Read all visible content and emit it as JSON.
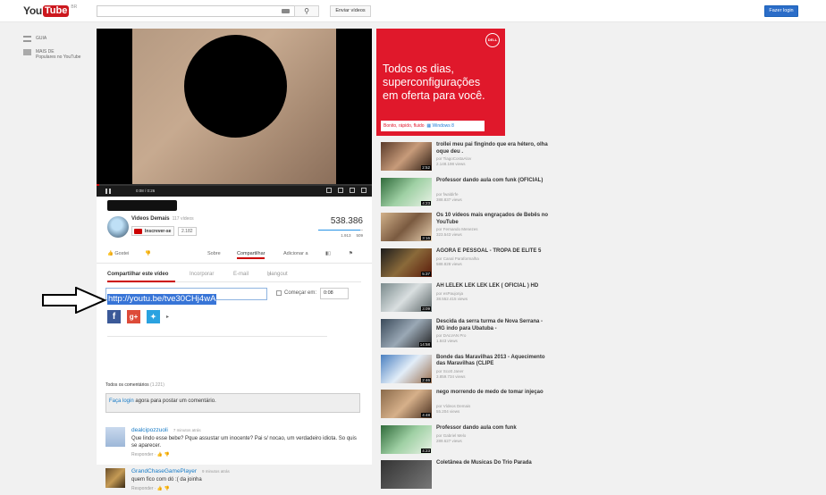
{
  "header": {
    "logo_you": "You",
    "logo_tube": "Tube",
    "logo_country": "BR",
    "search_placeholder": "",
    "upload_label": "Enviar vídeos",
    "login_label": "Fazer login"
  },
  "leftnav": {
    "items": [
      {
        "label": "GUIA",
        "sub": ""
      },
      {
        "label": "MAIS DE",
        "sub": "Populares no YouTube"
      }
    ]
  },
  "player": {
    "time": "0:08 / 0:26"
  },
  "video": {
    "channel": "Videos Demais",
    "channel_videos": "117 vídeos",
    "subscribe_label": "Inscrever-se",
    "subscriber_count": "2.182",
    "views": "538.386",
    "likes": "1.913",
    "dislikes": "509",
    "actions": {
      "like": "Gostei",
      "about": "Sobre",
      "share": "Compartilhar",
      "add": "Adicionar a"
    }
  },
  "share": {
    "tabs": [
      "Compartilhar este vídeo",
      "Incorporar",
      "E-mail",
      "Hangout"
    ],
    "url": "http://youtu.be/tve30CHj4wA",
    "start_label": "Começar em:",
    "start_time": "0:08"
  },
  "comments": {
    "header": "Todos os comentários",
    "count": "(1.221)",
    "login_link": "Faça login",
    "login_rest": " agora para postar um comentário.",
    "items": [
      {
        "name": "dealcipozzuoli",
        "time": "7 minutos atrás",
        "text": "Que lindo esse bebe? Pque assustar um inocente? Pai s/ nocao, um verdadeiro idiota. So quis se aparecer.",
        "reply": "Responder"
      },
      {
        "name": "GrandChaseGamePlayer",
        "time": "9 minutos atrás",
        "text": "quem fico com dó :( da joinha",
        "reply": "Responder"
      }
    ]
  },
  "ad": {
    "brand": "DELL",
    "line1": "Todos os dias,",
    "line2": "superconfigurações",
    "line3": "em oferta para você.",
    "tagline": "Bonito, rápido, fluido",
    "os": "Windows 8"
  },
  "related": [
    {
      "title": "trollei meu pai fingindo que era hétero, olha oque deu .",
      "by": "por TiagoCostaAlov",
      "views": "2.148.198 views",
      "duration": "2:52"
    },
    {
      "title": "Professor dando aula com funk (OFICIAL)",
      "by": "por fwaldirfe",
      "views": "388.837 views",
      "duration": "4:23"
    },
    {
      "title": "Os 10 vídeos mais engraçados de Bebês no YouTube",
      "by": "por Fernando Menezes",
      "views": "323.543 views",
      "duration": "3:16"
    },
    {
      "title": "AGORA E PESSOAL - TROPA DE ELITE 5",
      "by": "por Canal Paraformalha",
      "views": "588.828 views",
      "duration": "5:37"
    },
    {
      "title": "AH LELEK LEK LEK LEK ( OFICIAL ) HD",
      "by": "por esPaujonja",
      "views": "38.552.415 views",
      "duration": "3:09"
    },
    {
      "title": "Descida da serra turma de Nova Serrana - MG indo para Ubatuba -",
      "by": "por DALVAN Pro",
      "views": "1.843 views",
      "duration": "14:58"
    },
    {
      "title": "Bonde das Maravilhas 2013 - Aquecimento das Maravilhas (CLIPE",
      "by": "por Scott Janer",
      "views": "3.859.734 views",
      "duration": "2:46"
    },
    {
      "title": "nego morrendo de medo de tomar injeçao",
      "by": "por Vídeos Demais",
      "views": "55.204 views",
      "duration": "4:48"
    },
    {
      "title": "Professor dando aula com funk",
      "by": "por Gabriel Melo",
      "views": "289.627 views",
      "duration": "4:23"
    },
    {
      "title": "Coletânea de Musicas Do Trio Parada",
      "by": "",
      "views": "",
      "duration": ""
    }
  ],
  "colors": {
    "accent": "#cc181e",
    "link": "#167ac6",
    "ad": "#e0182b",
    "login": "#2b6dc8"
  }
}
